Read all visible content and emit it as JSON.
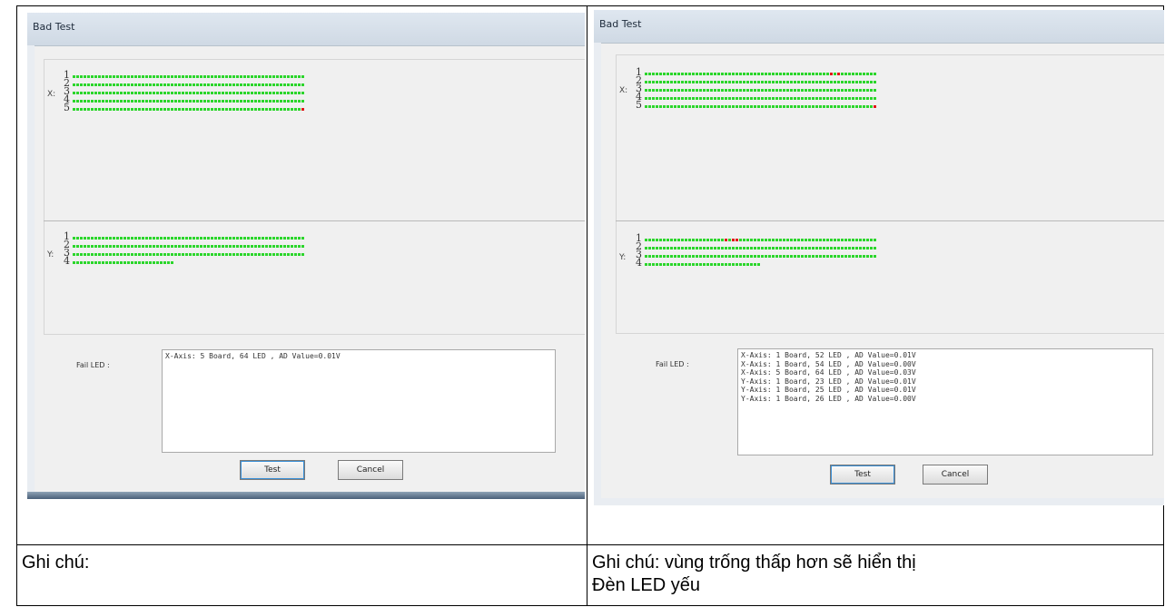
{
  "panels": [
    {
      "window_title": "Bad Test",
      "x_axis_label": "X:",
      "y_axis_label": "Y:",
      "x_rows": [
        {
          "num": "1",
          "count": 64,
          "fail": []
        },
        {
          "num": "2",
          "count": 64,
          "fail": []
        },
        {
          "num": "3",
          "count": 64,
          "fail": []
        },
        {
          "num": "4",
          "count": 64,
          "fail": []
        },
        {
          "num": "5",
          "count": 64,
          "fail": [
            64
          ]
        }
      ],
      "y_rows": [
        {
          "num": "1",
          "count": 64,
          "fail": []
        },
        {
          "num": "2",
          "count": 64,
          "fail": []
        },
        {
          "num": "3",
          "count": 64,
          "fail": []
        },
        {
          "num": "4",
          "count": 28,
          "fail": []
        }
      ],
      "fail_label": "Fail LED :",
      "fail_lines": [
        "X-Axis: 5 Board, 64 LED , AD Value=0.01V"
      ],
      "test_button": "Test",
      "cancel_button": "Cancel"
    },
    {
      "window_title": "Bad Test",
      "x_axis_label": "X:",
      "y_axis_label": "Y:",
      "x_rows": [
        {
          "num": "1",
          "count": 64,
          "fail": [
            52,
            54
          ]
        },
        {
          "num": "2",
          "count": 64,
          "fail": []
        },
        {
          "num": "3",
          "count": 64,
          "fail": []
        },
        {
          "num": "4",
          "count": 64,
          "fail": []
        },
        {
          "num": "5",
          "count": 64,
          "fail": [
            64
          ]
        }
      ],
      "y_rows": [
        {
          "num": "1",
          "count": 64,
          "fail": [
            23,
            25,
            26
          ]
        },
        {
          "num": "2",
          "count": 64,
          "fail": []
        },
        {
          "num": "3",
          "count": 64,
          "fail": []
        },
        {
          "num": "4",
          "count": 32,
          "fail": []
        }
      ],
      "fail_label": "Fail LED :",
      "fail_lines": [
        "X-Axis: 1 Board, 52 LED , AD Value=0.01V",
        "X-Axis: 1 Board, 54 LED , AD Value=0.00V",
        "X-Axis: 5 Board, 64 LED , AD Value=0.03V",
        "Y-Axis: 1 Board, 23 LED , AD Value=0.01V",
        "Y-Axis: 1 Board, 25 LED , AD Value=0.01V",
        "Y-Axis: 1 Board, 26 LED , AD Value=0.00V"
      ],
      "test_button": "Test",
      "cancel_button": "Cancel"
    }
  ],
  "notes": {
    "left": "Ghi chú:",
    "right": "Ghi chú: vùng trống thấp hơn sẽ hiển thị\nĐèn LED yếu"
  },
  "colors": {
    "led_ok": "#2bd62b",
    "led_fail": "#e01818"
  }
}
